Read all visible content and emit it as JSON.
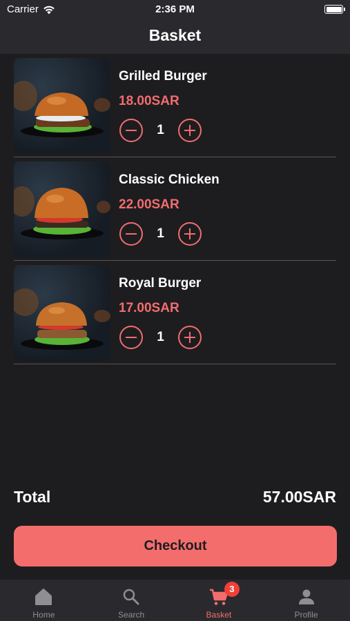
{
  "status_bar": {
    "carrier": "Carrier",
    "time": "2:36 PM"
  },
  "header": {
    "title": "Basket"
  },
  "basket": {
    "items": [
      {
        "name": "Grilled Burger",
        "price": "18.00SAR",
        "quantity": "1"
      },
      {
        "name": "Classic Chicken",
        "price": "22.00SAR",
        "quantity": "1"
      },
      {
        "name": "Royal Burger",
        "price": "17.00SAR",
        "quantity": "1"
      }
    ]
  },
  "summary": {
    "total_label": "Total",
    "total_value": "57.00SAR"
  },
  "checkout": {
    "label": "Checkout"
  },
  "tab_bar": {
    "tabs": [
      {
        "label": "Home",
        "icon": "home-icon"
      },
      {
        "label": "Search",
        "icon": "search-icon"
      },
      {
        "label": "Basket",
        "icon": "cart-icon",
        "badge": "3",
        "active": true
      },
      {
        "label": "Profile",
        "icon": "person-icon"
      }
    ]
  },
  "colors": {
    "background": "#1d1d20",
    "bar_background": "#2a2a2e",
    "accent": "#f36d6d",
    "badge": "#f0403a",
    "inactive_tab": "#8e8e93"
  }
}
